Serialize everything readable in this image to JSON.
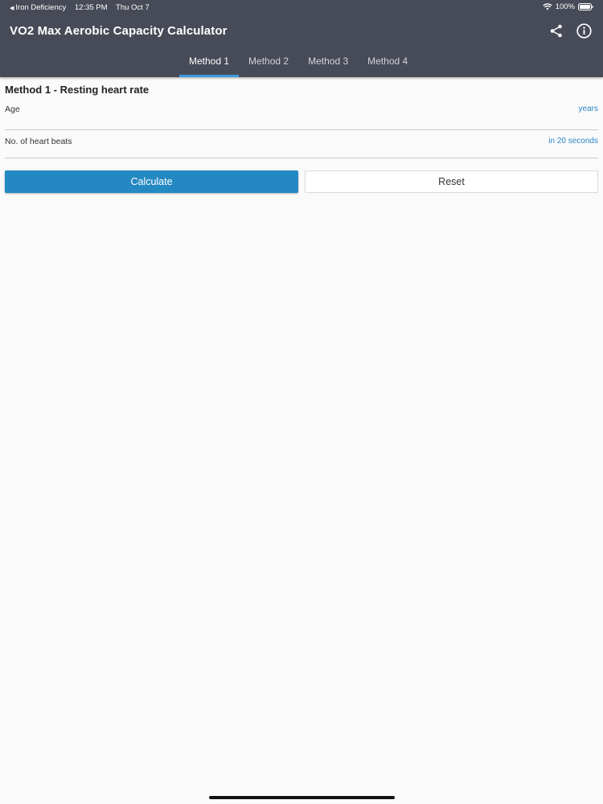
{
  "status_bar": {
    "back_app": "Iron Deficiency",
    "time": "12:35 PM",
    "date": "Thu Oct 7",
    "battery": "100%"
  },
  "header": {
    "title": "VO2 Max Aerobic Capacity Calculator",
    "share_icon": "share-icon",
    "info_icon": "info-icon"
  },
  "tabs": [
    {
      "label": "Method 1",
      "active": true
    },
    {
      "label": "Method 2",
      "active": false
    },
    {
      "label": "Method 3",
      "active": false
    },
    {
      "label": "Method 4",
      "active": false
    }
  ],
  "form": {
    "section_title": "Method 1 - Resting heart rate",
    "fields": [
      {
        "label": "Age",
        "value": "",
        "unit": "years"
      },
      {
        "label": "No. of heart beats",
        "value": "",
        "unit": "in 20 seconds"
      }
    ]
  },
  "buttons": {
    "calculate_label": "Calculate",
    "reset_label": "Reset"
  },
  "colors": {
    "header_bg": "#474b57",
    "accent": "#2489c2",
    "tab_indicator": "#3b9be0",
    "unit_text": "#2a86c4"
  }
}
